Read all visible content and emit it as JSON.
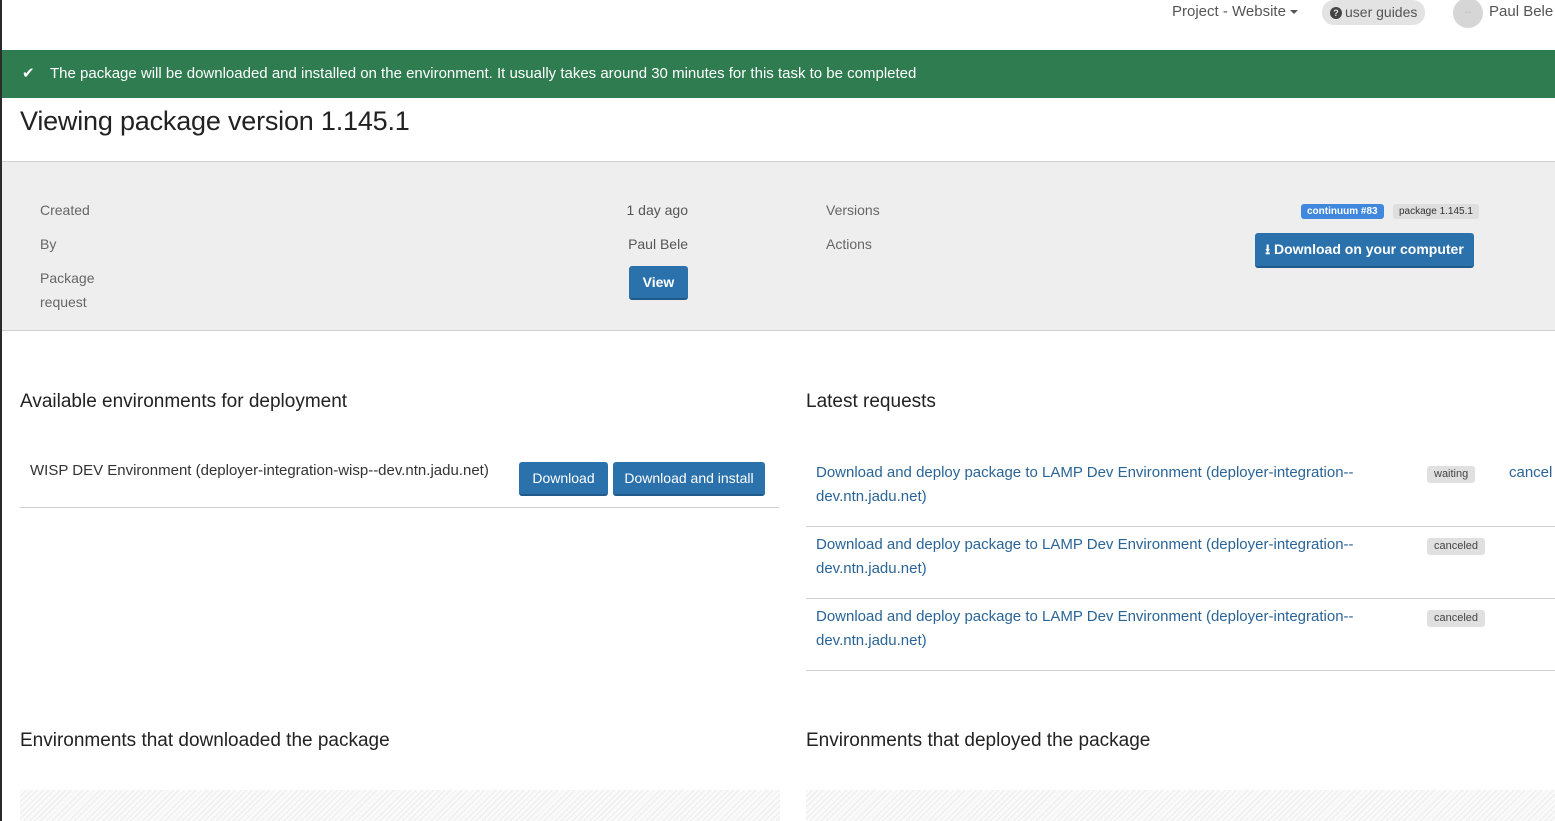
{
  "topnav": {
    "project_menu": "Project - Website",
    "user_guides": "user guides",
    "avatar_initials": "--",
    "user_name": "Paul Bele"
  },
  "alert": {
    "icon": "check-icon",
    "message": "The package will be downloaded and installed on the environment. It usually takes around 30 minutes for this task to be completed",
    "color": "#2e7c4f"
  },
  "page": {
    "title": "Viewing package version 1.145.1"
  },
  "info": {
    "created_label": "Created",
    "created_value": "1 day ago",
    "by_label": "By",
    "by_value": "Paul Bele",
    "package_request_label_1": "Package",
    "package_request_label_2": "request",
    "view_button": "View",
    "versions_label": "Versions",
    "versions_badges": [
      "continuum #83",
      "package 1.145.1"
    ],
    "actions_label": "Actions",
    "download_computer_button": "Download on your computer"
  },
  "available_environments": {
    "title": "Available environments for deployment",
    "items": [
      {
        "name": "WISP DEV Environment (deployer-integration-wisp--dev.ntn.jadu.net)",
        "download_label": "Download",
        "download_install_label": "Download and install"
      }
    ]
  },
  "latest_requests": {
    "title": "Latest requests",
    "items": [
      {
        "text": "Download and deploy package to LAMP Dev Environment (deployer-integration--dev.ntn.jadu.net)",
        "status": "waiting",
        "action": "cancel"
      },
      {
        "text": "Download and deploy package to LAMP Dev Environment (deployer-integration--dev.ntn.jadu.net)",
        "status": "canceled"
      },
      {
        "text": "Download and deploy package to LAMP Dev Environment (deployer-integration--dev.ntn.jadu.net)",
        "status": "canceled"
      }
    ]
  },
  "downloaded_section": {
    "title": "Environments that downloaded the package"
  },
  "deployed_section": {
    "title": "Environments that deployed the package"
  }
}
